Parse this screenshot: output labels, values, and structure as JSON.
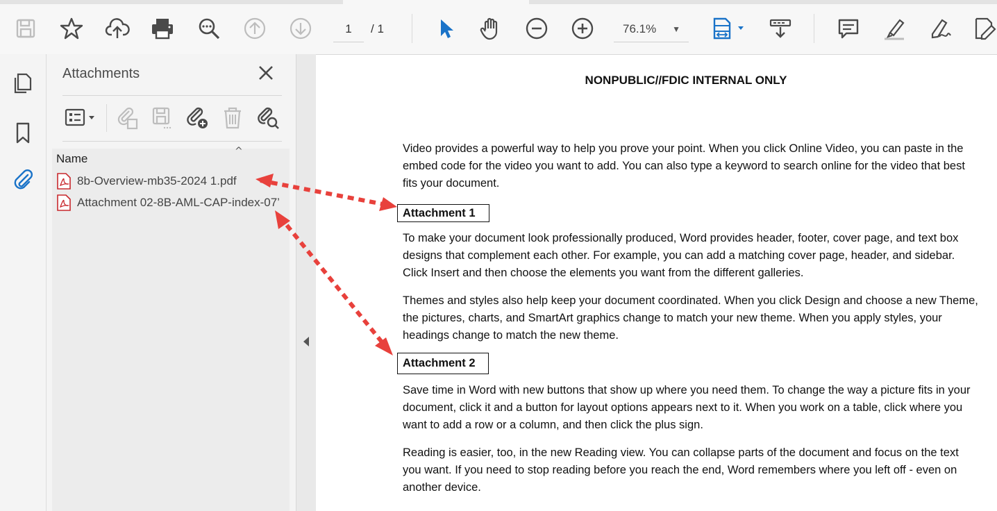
{
  "toolbar": {
    "page_current": "1",
    "page_total": "/ 1",
    "zoom_value": "76.1%",
    "icons": [
      "save-icon",
      "bookmark-star-icon",
      "upload-cloud-icon",
      "print-icon",
      "zoom-search-icon",
      "page-up-icon",
      "page-down-icon",
      "select-cursor-icon",
      "hand-tool-icon",
      "zoom-out-icon",
      "zoom-in-icon",
      "fit-page-icon",
      "read-mode-icon",
      "comment-icon",
      "highlight-icon",
      "sign-icon",
      "edit-pdf-icon"
    ]
  },
  "rail": {
    "items": [
      "pages-thumbnails-icon",
      "bookmarks-icon",
      "attachments-paperclip-icon"
    ]
  },
  "attachments_panel": {
    "title": "Attachments",
    "column_header": "Name",
    "files": [
      {
        "name": "8b-Overview-mb35-2024 1.pdf"
      },
      {
        "name": "Attachment 02-8B-AML-CAP-index-07’"
      }
    ]
  },
  "document": {
    "header": "NONPUBLIC//FDIC INTERNAL ONLY",
    "para1": "Video provides a powerful way to help you prove your point. When you click Online Video, you can paste in the embed code for the video you want to add. You can also type a keyword to search online for the video that best fits your document.",
    "attachment1_label": "Attachment 1",
    "para2": "To make your document look professionally produced, Word provides header, footer, cover page, and text box designs that complement each other. For example, you can add a matching cover page, header, and sidebar. Click Insert and then choose the elements you want from the different galleries.",
    "para3": "Themes and styles also help keep your document coordinated. When you click Design and choose a new Theme, the pictures, charts, and SmartArt graphics change to match your new theme. When you apply styles, your headings change to match the new theme.",
    "attachment2_label": "Attachment 2",
    "para4": "Save time in Word with new buttons that show up where you need them. To change the way a picture fits in your document, click it and a button for layout options appears next to it. When you work on a table, click where you want to add a row or a column, and then click the plus sign.",
    "para5": "Reading is easier, too, in the new Reading view. You can collapse parts of the document and focus on the text you want. If you need to stop reading before you reach the end, Word remembers where you left off - even on another device."
  },
  "colors": {
    "accent_blue": "#1a73c8",
    "arrow_red": "#e8413c",
    "icon_gray": "#4a4a4a",
    "disabled_gray": "#b5b5b5"
  }
}
